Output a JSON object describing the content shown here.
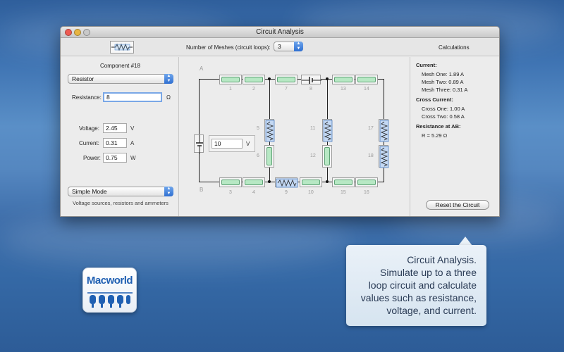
{
  "window": {
    "title": "Circuit Analysis",
    "toolbar": {
      "meshes_label": "Number of Meshes (circuit loops):",
      "meshes_value": "3",
      "calculations_label": "Calculations"
    }
  },
  "left_panel": {
    "component_title": "Component #18",
    "component_type": "Resistor",
    "resistance_label": "Resistance:",
    "resistance_value": "8",
    "resistance_unit": "Ω",
    "voltage_label": "Voltage:",
    "voltage_value": "2.45",
    "voltage_unit": "V",
    "current_label": "Current:",
    "current_value": "0.31",
    "current_unit": "A",
    "power_label": "Power:",
    "power_value": "0.75",
    "power_unit": "W",
    "mode_value": "Simple Mode",
    "mode_description": "Voltage sources, resistors and ammeters"
  },
  "circuit": {
    "node_a": "A",
    "node_b": "B",
    "source_value": "10",
    "source_unit": "V",
    "labels": {
      "c1": "1",
      "c2": "2",
      "c3": "3",
      "c4": "4",
      "c5": "5",
      "c6": "6",
      "c7": "7",
      "c8": "8",
      "c9": "9",
      "c10": "10",
      "c11": "11",
      "c12": "12",
      "c13": "13",
      "c14": "14",
      "c15": "15",
      "c16": "16",
      "c17": "17",
      "c18": "18"
    }
  },
  "calculations": {
    "current_heading": "Current:",
    "mesh_one": "Mesh One:  1.89 A",
    "mesh_two": "Mesh Two:  0.89 A",
    "mesh_three": "Mesh Three:  0.31 A",
    "cross_heading": "Cross Current:",
    "cross_one": "Cross One:  1.00 A",
    "cross_two": "Cross Two:  0.58 A",
    "resistance_heading": "Resistance at AB:",
    "resistance_ab": "R = 5.29 Ω",
    "reset_button": "Reset the Circuit"
  },
  "callout": {
    "line1": "Circuit Analysis.",
    "line2": "Simulate up to a three",
    "line3": "loop circuit and calculate",
    "line4": "values such as resistance,",
    "line5": "voltage, and current."
  },
  "badge": {
    "text": "Macworld"
  }
}
